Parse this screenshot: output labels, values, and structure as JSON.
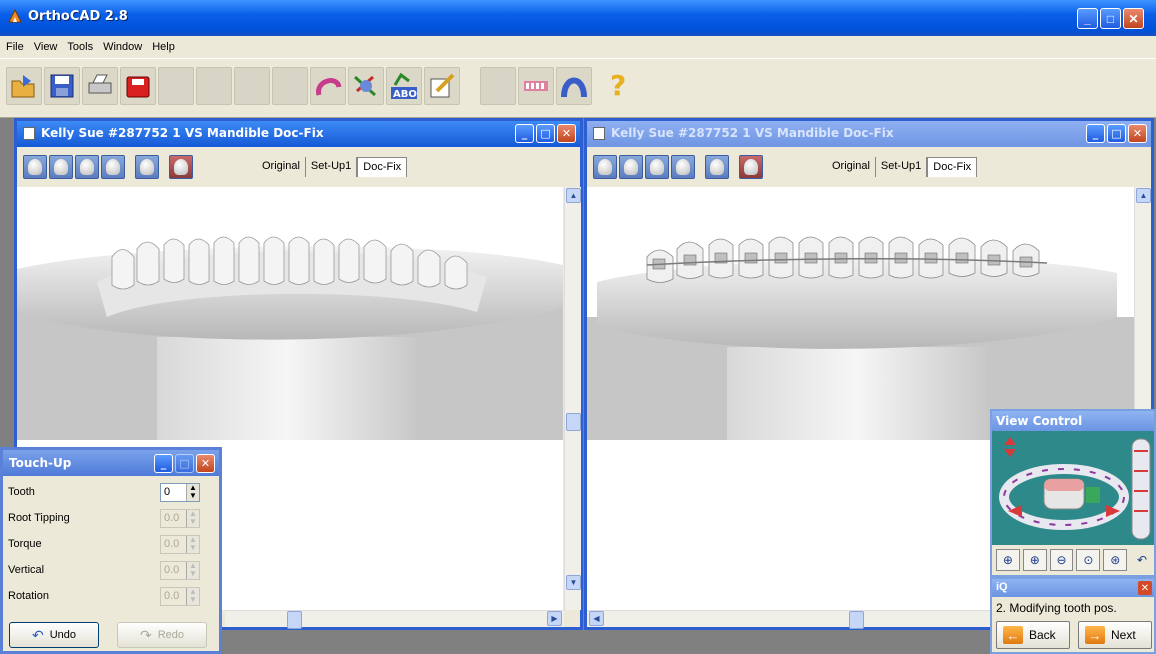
{
  "app": {
    "title": "OrthoCAD 2.8",
    "window_buttons": {
      "minimize": "_",
      "maximize": "□",
      "close": "✕"
    }
  },
  "menu": [
    "File",
    "View",
    "Tools",
    "Window",
    "Help"
  ],
  "toolbar": {
    "help_glyph": "?"
  },
  "left_window": {
    "title": "Kelly Sue #287752 1 VS Mandible Doc-Fix",
    "tabs": [
      "Original",
      "Set-Up1",
      "Doc-Fix"
    ],
    "active_tab": "Doc-Fix"
  },
  "right_window": {
    "title": "Kelly Sue #287752 1 VS Mandible Doc-Fix",
    "tabs": [
      "Original",
      "Set-Up1",
      "Doc-Fix"
    ],
    "active_tab": "Doc-Fix"
  },
  "touchup": {
    "title": "Touch-Up",
    "fields": [
      {
        "label": "Tooth",
        "value": "0",
        "enabled": true
      },
      {
        "label": "Root Tipping",
        "value": "0.0",
        "enabled": false
      },
      {
        "label": "Torque",
        "value": "0.0",
        "enabled": false
      },
      {
        "label": "Vertical",
        "value": "0.0",
        "enabled": false
      },
      {
        "label": "Rotation",
        "value": "0.0",
        "enabled": false
      }
    ],
    "undo_label": "Undo",
    "redo_label": "Redo"
  },
  "view_control": {
    "title": "View Control"
  },
  "iq": {
    "title": "iQ",
    "step_text": "2. Modifying tooth pos.",
    "back_label": "Back",
    "next_label": "Next"
  },
  "colors": {
    "title_blue": "#0a5fe8",
    "close_red": "#c2451f",
    "view_control_teal": "#2e8a8a"
  }
}
